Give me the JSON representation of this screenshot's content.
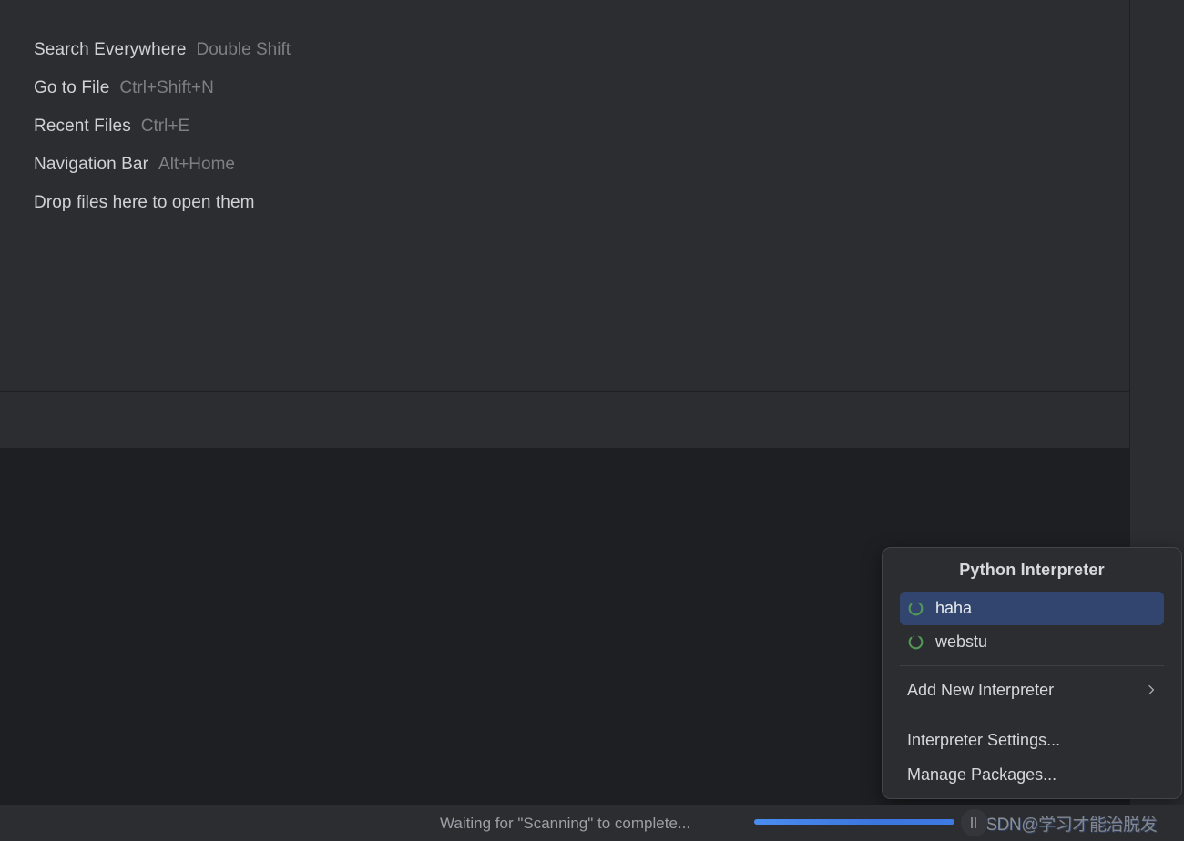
{
  "editor": {
    "hints": [
      {
        "action": "Search Everywhere",
        "shortcut": "Double Shift"
      },
      {
        "action": "Go to File",
        "shortcut": "Ctrl+Shift+N"
      },
      {
        "action": "Recent Files",
        "shortcut": "Ctrl+E"
      },
      {
        "action": "Navigation Bar",
        "shortcut": "Alt+Home"
      },
      {
        "action": "Drop files here to open them",
        "shortcut": ""
      }
    ]
  },
  "interpreter_popup": {
    "title": "Python Interpreter",
    "environments": [
      {
        "label": "haha",
        "icon": "python-env-icon",
        "selected": true
      },
      {
        "label": "webstu",
        "icon": "python-env-icon",
        "selected": false
      }
    ],
    "add_new": {
      "label": "Add New Interpreter",
      "icon": "chevron-right-icon"
    },
    "actions": [
      {
        "label": "Interpreter Settings..."
      },
      {
        "label": "Manage Packages..."
      }
    ],
    "selection_color": "#31456e",
    "env_icon_color": "#4f9a52"
  },
  "status_bar": {
    "progress_text": "Waiting for \"Scanning\" to complete...",
    "progress_percent": 100,
    "progress_color": "#3b82f0"
  },
  "watermark": {
    "logo": "csdn-logo-icon",
    "brand": "CSDN",
    "handle": "@学习才能治脱发"
  }
}
